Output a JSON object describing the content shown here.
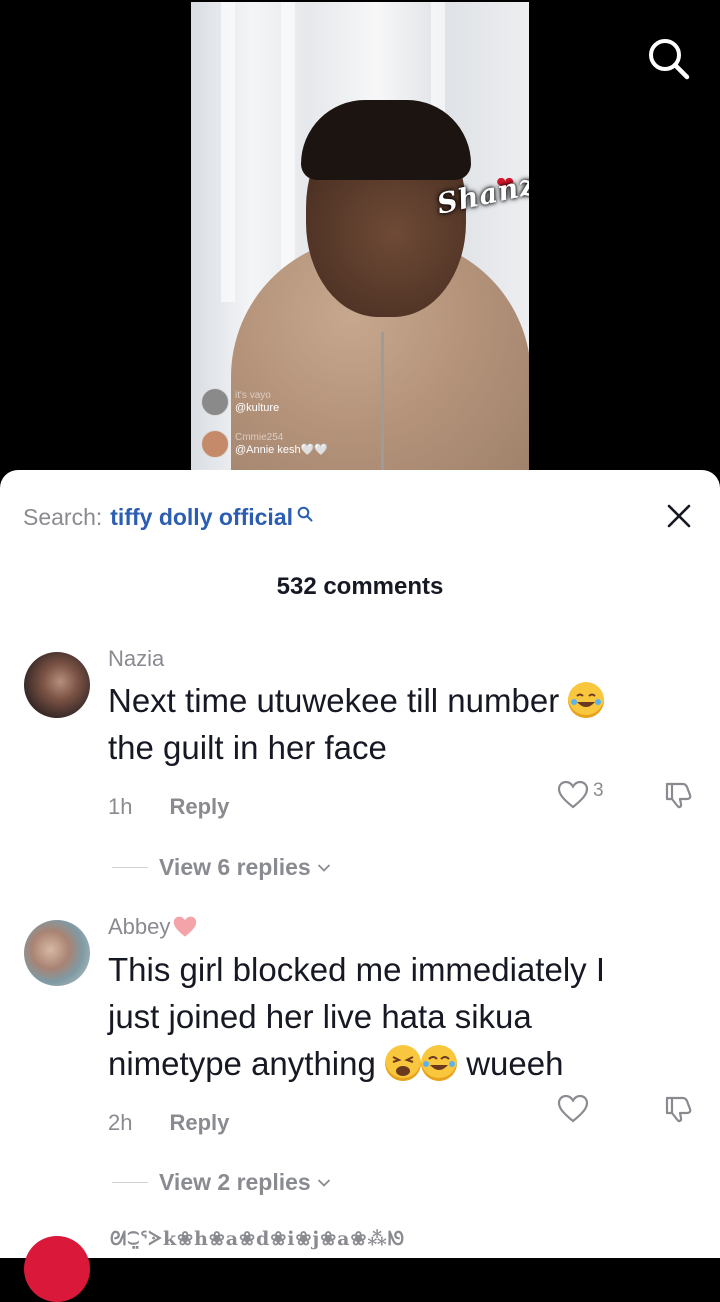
{
  "video": {
    "sticker_text": "Shanzey",
    "live_rows": [
      {
        "sub": "it's vayo",
        "name": "@kulture"
      },
      {
        "sub": "Cmmie254",
        "name": "@Annie kesh🤍🤍"
      }
    ]
  },
  "sheet": {
    "search_prefix": "Search:",
    "search_term": "tiffy dolly official",
    "comment_count": "532 comments"
  },
  "comments": [
    {
      "username": "Nazia",
      "text_line1": "Next time utuwekee till number",
      "text_line2": "the guilt in her face",
      "emoji": "rolling-on-floor-laughing",
      "time": "1h",
      "reply_label": "Reply",
      "likes": "3",
      "view_replies": "View 6 replies"
    },
    {
      "username": "Abbey",
      "username_badge": "pink-heart",
      "text_line1": "This girl blocked me immediately I",
      "text_line2": "just joined her live hata sikua",
      "text_line3_a": "nimetype anything",
      "text_line3_b": "wueeh",
      "emojis": [
        "weary-face",
        "face-with-tears-of-joy"
      ],
      "time": "2h",
      "reply_label": "Reply",
      "likes": "",
      "view_replies": "View 2 replies"
    },
    {
      "username": "ᘛ⁐̤ᕐᐷk❀h❀a❀d❀i❀j❀a❀⁂ᘚ"
    }
  ],
  "colors": {
    "link_blue": "#2b5db3",
    "secondary_gray": "#8a8b91",
    "text_dark": "#161823",
    "heart_pink": "#f4a3a8"
  }
}
